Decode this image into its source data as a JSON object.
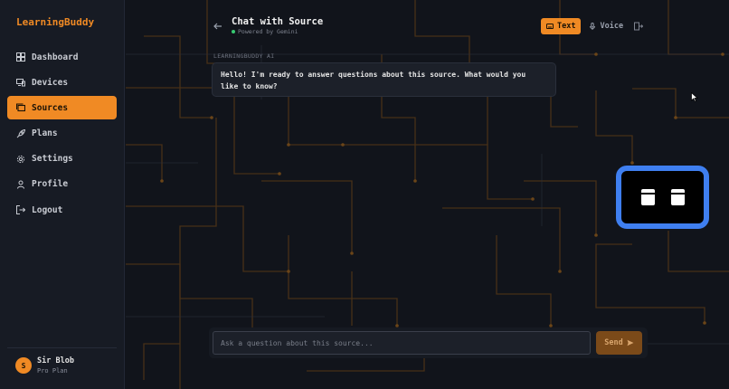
{
  "app": {
    "brand": "LearningBuddy"
  },
  "sidebar": {
    "items": [
      {
        "label": "Dashboard",
        "icon": "dashboard-icon",
        "active": false
      },
      {
        "label": "Devices",
        "icon": "devices-icon",
        "active": false
      },
      {
        "label": "Sources",
        "icon": "sources-icon",
        "active": true
      },
      {
        "label": "Plans",
        "icon": "rocket-icon",
        "active": false
      },
      {
        "label": "Settings",
        "icon": "gear-icon",
        "active": false
      },
      {
        "label": "Profile",
        "icon": "user-icon",
        "active": false
      },
      {
        "label": "Logout",
        "icon": "logout-icon",
        "active": false
      }
    ],
    "user": {
      "initial": "S",
      "name": "Sir Blob",
      "plan": "Pro Plan"
    }
  },
  "chat": {
    "title": "Chat with Source",
    "subtitle": "Powered by Gemini",
    "modes": {
      "text": "Text",
      "voice": "Voice",
      "selected": "Text"
    },
    "messages": [
      {
        "sender": "LEARNINGBUDDY AI",
        "text": "Hello! I'm ready to answer questions about this source. What would you like to know?"
      }
    ],
    "input": {
      "placeholder": "Ask a question about this source...",
      "value": ""
    },
    "send_label": "Send"
  },
  "colors": {
    "accent": "#f08a24",
    "background": "#11141b",
    "sidebar": "#171b24",
    "robot_frame": "#3f7ff0",
    "status_online": "#37c871"
  }
}
